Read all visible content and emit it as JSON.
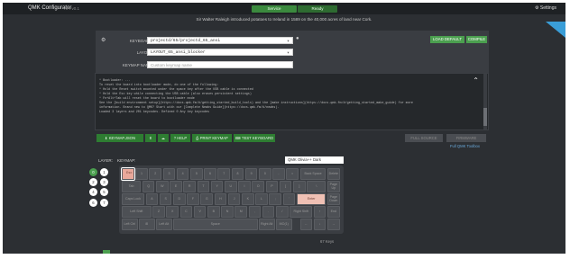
{
  "app": {
    "title": "QMK Configurator",
    "version": "API v0.1"
  },
  "topbar": {
    "service_label": "Service",
    "ready_label": "Ready",
    "settings_label": "Settings"
  },
  "status_message": "Sir Walter Raleigh introduced potatoes to Ireland in 1589 on the 40,000 acres of land near Cork.",
  "config": {
    "keyboard_label": "KEYBOARD:",
    "keyboard_value": "projectd/65/projectd_65_ansi",
    "layout_label": "LAYOUT:",
    "layout_value": "LAYOUT_65_ansi_blocker",
    "keymap_name_label": "KEYMAP NAME:",
    "keymap_name_placeholder": "Custom keymap name",
    "load_default_label": "LOAD DEFAULT",
    "compile_label": "COMPILE"
  },
  "console": {
    "lines": [
      "* Bootloader: ...",
      "",
      "To reset the board into bootloader mode, do one of the following:",
      "",
      "* Hold the Reset switch mounted under the space key after the USB cable is connected",
      "* Hold the Esc key while connecting the USB cable (also erases persistent settings)",
      "* Fn+Alt+Tab will reset the board to bootloader mode",
      "",
      "See the [build environment setup](https://docs.qmk.fm/#/getting_started_build_tools) and the [make instructions](https://docs.qmk.fm/#/getting_started_make_guide) for more",
      "information. Brand new to QMK? Start with our [Complete Newbs Guide](https://docs.qmk.fm/#/newbs).",
      "",
      "Loaded 3 layers and 201 keycodes. Defined 0 Any key keycodes"
    ]
  },
  "toolbar": {
    "keymap_json": "KEYMAP.JSON",
    "print_keymap": "PRINT KEYMAP",
    "test_keyboard": "TEST KEYBOARD",
    "help": "HELP",
    "full_source": "FULL SOURCE",
    "firmware": "FIRMWARE",
    "full_tester_link": "Full QMK Toolbox"
  },
  "keyboard_area": {
    "layer_label": "LAYER:",
    "keymap_label": "KEYMAP:",
    "theme_select": "QMK Olivia++ Dark",
    "layers": [
      "0",
      "1",
      "2",
      "3",
      "4",
      "5",
      "6",
      "7"
    ],
    "active_layer": "0",
    "key_count": "67 Keys"
  },
  "keys": [
    {
      "label": "Esc"
    },
    {
      "label": "1"
    },
    {
      "label": "2"
    },
    {
      "label": "3"
    },
    {
      "label": "4"
    },
    {
      "label": "5"
    },
    {
      "label": "6"
    },
    {
      "label": "7"
    },
    {
      "label": "8"
    },
    {
      "label": "9"
    },
    {
      "label": "0"
    },
    {
      "label": "-"
    },
    {
      "label": "="
    },
    {
      "label": "Back Space"
    },
    {
      "label": "Delete"
    },
    {
      "label": "Tab"
    },
    {
      "label": "Q"
    },
    {
      "label": "W"
    },
    {
      "label": "E"
    },
    {
      "label": "R"
    },
    {
      "label": "T"
    },
    {
      "label": "Y"
    },
    {
      "label": "U"
    },
    {
      "label": "I"
    },
    {
      "label": "O"
    },
    {
      "label": "P"
    },
    {
      "label": "["
    },
    {
      "label": "]"
    },
    {
      "label": "\\"
    },
    {
      "label": "Page Up"
    },
    {
      "label": "Caps Lock"
    },
    {
      "label": "A"
    },
    {
      "label": "S"
    },
    {
      "label": "D"
    },
    {
      "label": "F"
    },
    {
      "label": "G"
    },
    {
      "label": "H"
    },
    {
      "label": "J"
    },
    {
      "label": "K"
    },
    {
      "label": "L"
    },
    {
      "label": ";"
    },
    {
      "label": "'"
    },
    {
      "label": "Enter"
    },
    {
      "label": "Page Down"
    },
    {
      "label": "Left Shift"
    },
    {
      "label": "Z"
    },
    {
      "label": "X"
    },
    {
      "label": "C"
    },
    {
      "label": "V"
    },
    {
      "label": "B"
    },
    {
      "label": "N"
    },
    {
      "label": "M"
    },
    {
      "label": ","
    },
    {
      "label": "."
    },
    {
      "label": "/"
    },
    {
      "label": "Right Shift"
    },
    {
      "label": "↑"
    },
    {
      "label": "End"
    },
    {
      "label": "Left Ctrl"
    },
    {
      "label": "⊞"
    },
    {
      "label": "Left Alt"
    },
    {
      "label": "Space"
    },
    {
      "label": "Right Alt"
    },
    {
      "label": "MO(1)"
    },
    {
      "label": "←"
    },
    {
      "label": "↓"
    },
    {
      "label": "→"
    }
  ],
  "colors": {
    "accent": "#4b9f4f",
    "highlight_key": "#e9a89b",
    "link": "#6aa8d8"
  }
}
